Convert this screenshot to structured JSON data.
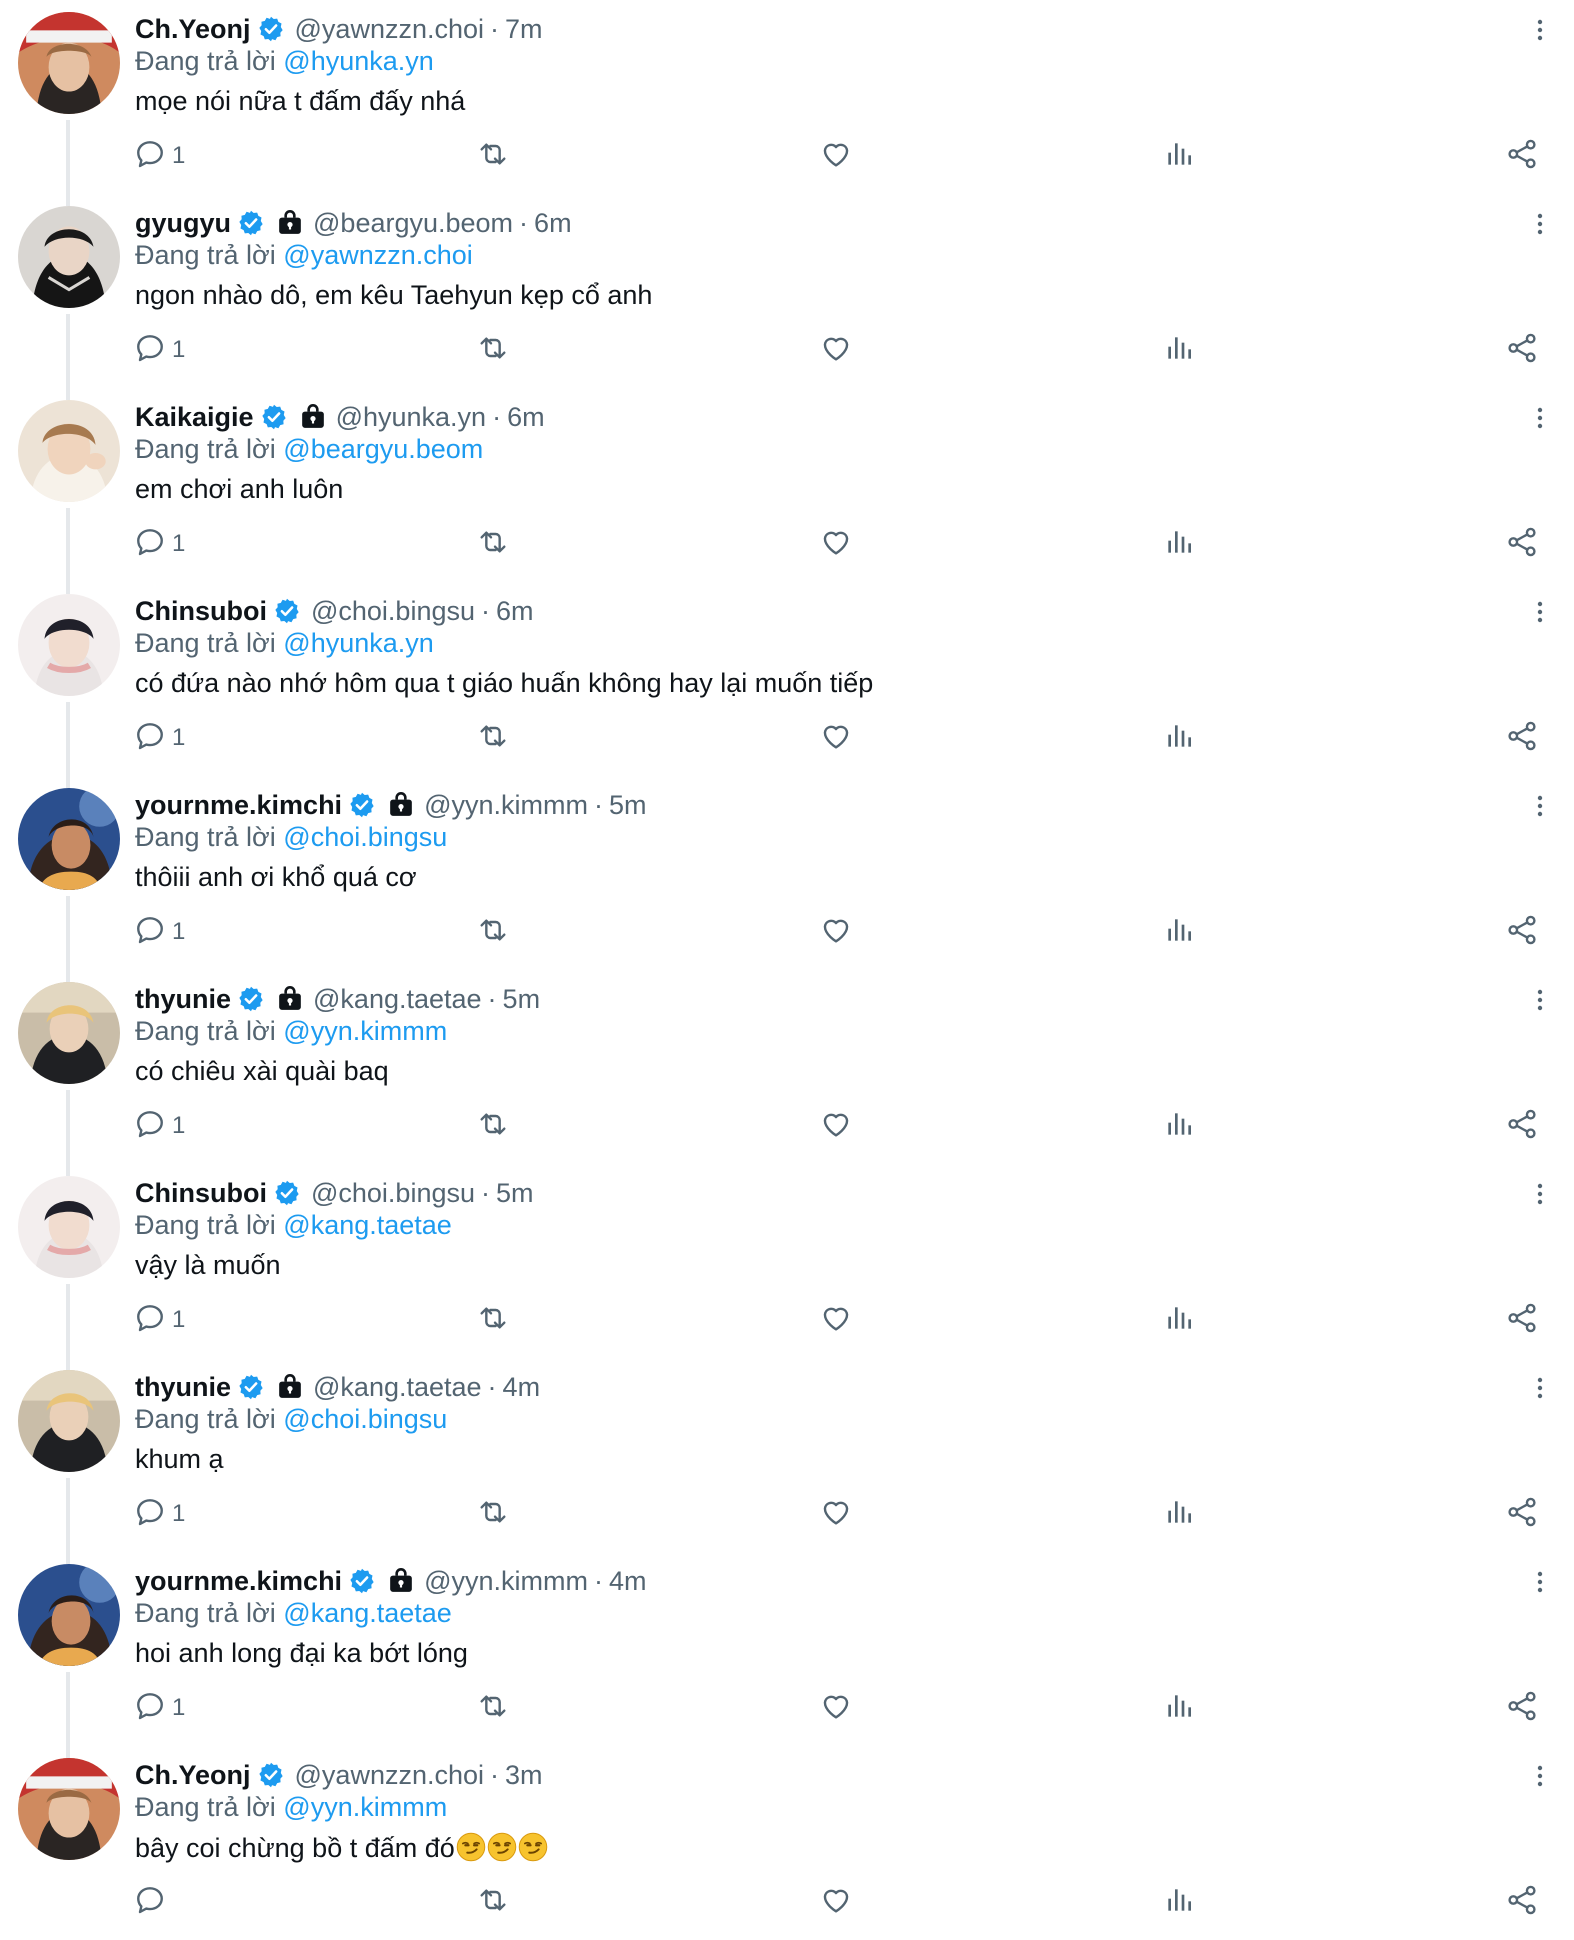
{
  "reply_prefix": "Đang trả lời",
  "colors": {
    "accent": "#1d9bf0",
    "muted": "#536471",
    "text": "#0f1419",
    "thread_line": "#e5e8eb"
  },
  "icons": {
    "verified": "verified-badge-icon",
    "lock": "locked-account-icon",
    "more": "more-options-icon",
    "reply": "reply-icon",
    "retweet": "retweet-icon",
    "like": "like-icon",
    "views": "views-icon",
    "share": "share-icon"
  },
  "tweets": [
    {
      "name": "Ch.Yeonj",
      "handle": "@yawnzzn.choi",
      "time": "7m",
      "locked": false,
      "reply_to": "@hyunka.yn",
      "text": "mọe nói nữa t đấm đấy nhá",
      "reply_count": "1",
      "avatar_theme": "yeonj"
    },
    {
      "name": "gyugyu",
      "handle": "@beargyu.beom",
      "time": "6m",
      "locked": true,
      "reply_to": "@yawnzzn.choi",
      "text": "ngon nhào dô, em kêu Taehyun kẹp cổ anh",
      "reply_count": "1",
      "avatar_theme": "gyu"
    },
    {
      "name": "Kaikaigie",
      "handle": "@hyunka.yn",
      "time": "6m",
      "locked": true,
      "reply_to": "@beargyu.beom",
      "text": "em chơi anh luôn",
      "reply_count": "1",
      "avatar_theme": "kai"
    },
    {
      "name": "Chinsuboi",
      "handle": "@choi.bingsu",
      "time": "6m",
      "locked": false,
      "reply_to": "@hyunka.yn",
      "text": "có đứa nào nhớ hôm qua t giáo huấn không hay lại muốn tiếp",
      "reply_count": "1",
      "avatar_theme": "bingsu"
    },
    {
      "name": "yournme.kimchi",
      "handle": "@yyn.kimmm",
      "time": "5m",
      "locked": true,
      "reply_to": "@choi.bingsu",
      "text": "thôiii anh ơi khổ quá cơ",
      "reply_count": "1",
      "avatar_theme": "kimchi"
    },
    {
      "name": "thyunie",
      "handle": "@kang.taetae",
      "time": "5m",
      "locked": true,
      "reply_to": "@yyn.kimmm",
      "text": "có chiêu xài quài baq",
      "reply_count": "1",
      "avatar_theme": "thyunie"
    },
    {
      "name": "Chinsuboi",
      "handle": "@choi.bingsu",
      "time": "5m",
      "locked": false,
      "reply_to": "@kang.taetae",
      "text": "vậy là muốn",
      "reply_count": "1",
      "avatar_theme": "bingsu"
    },
    {
      "name": "thyunie",
      "handle": "@kang.taetae",
      "time": "4m",
      "locked": true,
      "reply_to": "@choi.bingsu",
      "text": "khum ạ",
      "reply_count": "1",
      "avatar_theme": "thyunie"
    },
    {
      "name": "yournme.kimchi",
      "handle": "@yyn.kimmm",
      "time": "4m",
      "locked": true,
      "reply_to": "@kang.taetae",
      "text": "hoi anh long đại ka bớt lóng",
      "reply_count": "1",
      "avatar_theme": "kimchi"
    },
    {
      "name": "Ch.Yeonj",
      "handle": "@yawnzzn.choi",
      "time": "3m",
      "locked": false,
      "reply_to": "@yyn.kimmm",
      "text": "bây coi chừng bồ t đấm đó",
      "emoji": "smirking-face-emoji",
      "emoji_count": 3,
      "reply_count": "",
      "avatar_theme": "yeonj"
    }
  ]
}
